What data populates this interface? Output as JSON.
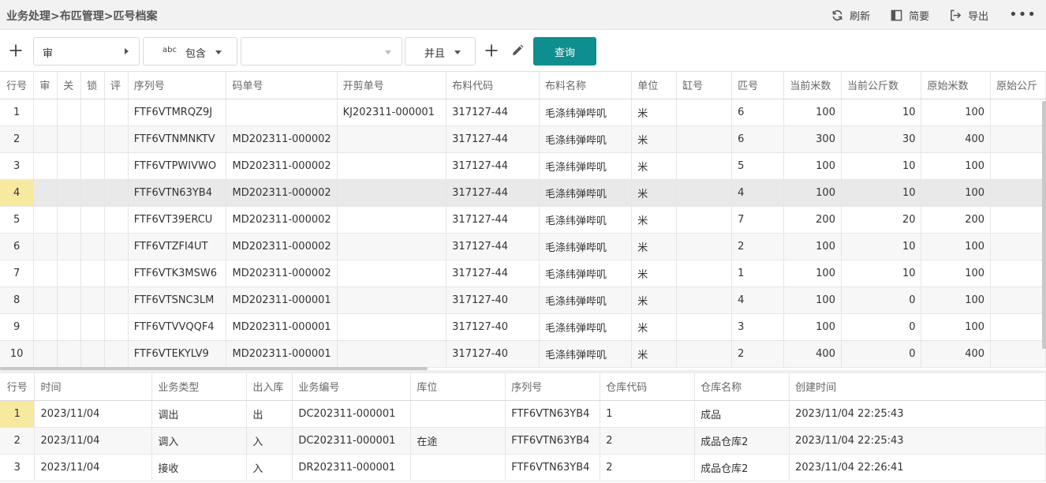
{
  "breadcrumb": "业务处理>布匹管理>匹号档案",
  "top_actions": [
    {
      "icon": "refresh-icon",
      "label": "刷新"
    },
    {
      "icon": "summary-icon",
      "label": "简要"
    },
    {
      "icon": "export-icon",
      "label": "导出"
    }
  ],
  "toolbar": {
    "field_value": "审",
    "operator_label": "包含",
    "operator_icon_text": "abc",
    "input_value": "",
    "logic_label": "并且",
    "query_label": "查询"
  },
  "main_grid": {
    "columns": [
      "行号",
      "审",
      "关",
      "锁",
      "评",
      "序列号",
      "码单号",
      "开剪单号",
      "布料代码",
      "布料名称",
      "单位",
      "缸号",
      "匹号",
      "当前米数",
      "当前公斤数",
      "原始米数",
      "原始公斤"
    ],
    "selected_row": 4,
    "rows": [
      [
        "1",
        "",
        "",
        "",
        "",
        "FTF6VTMRQZ9J",
        "",
        "KJ202311-000001",
        "317127-44",
        "毛涤纬弹哔叽",
        "米",
        "",
        "6",
        "100",
        "10",
        "100",
        ""
      ],
      [
        "2",
        "",
        "",
        "",
        "",
        "FTF6VTNMNKTV",
        "MD202311-000002",
        "",
        "317127-44",
        "毛涤纬弹哔叽",
        "米",
        "",
        "6",
        "300",
        "30",
        "400",
        ""
      ],
      [
        "3",
        "",
        "",
        "",
        "",
        "FTF6VTPWIVWO",
        "MD202311-000002",
        "",
        "317127-44",
        "毛涤纬弹哔叽",
        "米",
        "",
        "5",
        "100",
        "10",
        "100",
        ""
      ],
      [
        "4",
        "",
        "",
        "",
        "",
        "FTF6VTN63YB4",
        "MD202311-000002",
        "",
        "317127-44",
        "毛涤纬弹哔叽",
        "米",
        "",
        "4",
        "100",
        "10",
        "100",
        ""
      ],
      [
        "5",
        "",
        "",
        "",
        "",
        "FTF6VT39ERCU",
        "MD202311-000002",
        "",
        "317127-44",
        "毛涤纬弹哔叽",
        "米",
        "",
        "7",
        "200",
        "20",
        "200",
        ""
      ],
      [
        "6",
        "",
        "",
        "",
        "",
        "FTF6VTZFI4UT",
        "MD202311-000002",
        "",
        "317127-44",
        "毛涤纬弹哔叽",
        "米",
        "",
        "2",
        "100",
        "10",
        "100",
        ""
      ],
      [
        "7",
        "",
        "",
        "",
        "",
        "FTF6VTK3MSW6",
        "MD202311-000002",
        "",
        "317127-44",
        "毛涤纬弹哔叽",
        "米",
        "",
        "1",
        "100",
        "10",
        "100",
        ""
      ],
      [
        "8",
        "",
        "",
        "",
        "",
        "FTF6VTSNC3LM",
        "MD202311-000001",
        "",
        "317127-40",
        "毛涤纬弹哔叽",
        "米",
        "",
        "4",
        "100",
        "0",
        "100",
        ""
      ],
      [
        "9",
        "",
        "",
        "",
        "",
        "FTF6VTVVQQF4",
        "MD202311-000001",
        "",
        "317127-40",
        "毛涤纬弹哔叽",
        "米",
        "",
        "3",
        "100",
        "0",
        "100",
        ""
      ],
      [
        "10",
        "",
        "",
        "",
        "",
        "FTF6VTEKYLV9",
        "MD202311-000001",
        "",
        "317127-40",
        "毛涤纬弹哔叽",
        "米",
        "",
        "2",
        "400",
        "0",
        "400",
        ""
      ]
    ]
  },
  "detail_grid": {
    "columns": [
      "行号",
      "时间",
      "业务类型",
      "出入库",
      "业务编号",
      "库位",
      "序列号",
      "仓库代码",
      "仓库名称",
      "创建时间"
    ],
    "marked_row": 1,
    "rows": [
      [
        "1",
        "2023/11/04",
        "调出",
        "出",
        "DC202311-000001",
        "",
        "FTF6VTN63YB4",
        "1",
        "成品",
        "2023/11/04 22:25:43"
      ],
      [
        "2",
        "2023/11/04",
        "调入",
        "入",
        "DC202311-000001",
        "在途",
        "FTF6VTN63YB4",
        "2",
        "成品仓库2",
        "2023/11/04 22:25:43"
      ],
      [
        "3",
        "2023/11/04",
        "接收",
        "入",
        "DR202311-000001",
        "",
        "FTF6VTN63YB4",
        "2",
        "成品仓库2",
        "2023/11/04 22:26:41"
      ]
    ]
  }
}
